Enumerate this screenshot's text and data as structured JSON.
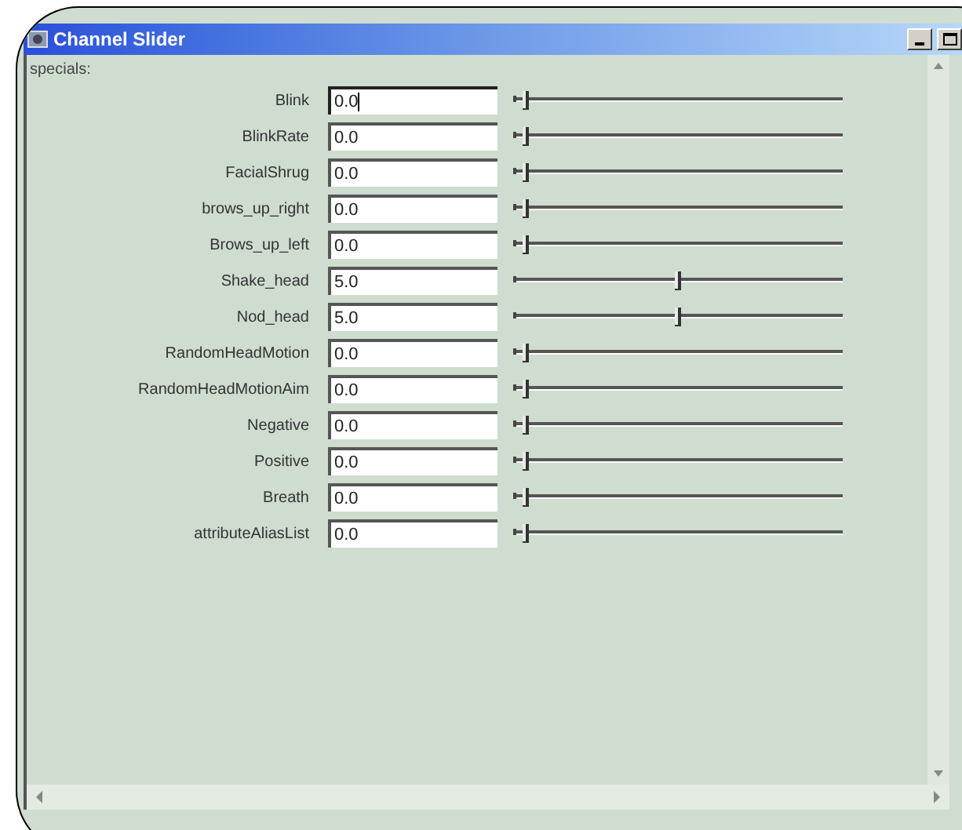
{
  "window": {
    "title": "Channel Slider"
  },
  "section": {
    "label": "specials:"
  },
  "channels": [
    {
      "name": "Blink",
      "value": "0.0",
      "level": 0,
      "focused": true
    },
    {
      "name": "BlinkRate",
      "value": "0.0",
      "level": 0,
      "focused": false
    },
    {
      "name": "FacialShrug",
      "value": "0.0",
      "level": 0,
      "focused": false
    },
    {
      "name": "brows_up_right",
      "value": "0.0",
      "level": 0,
      "focused": false
    },
    {
      "name": "Brows_up_left",
      "value": "0.0",
      "level": 0,
      "focused": false
    },
    {
      "name": "Shake_head",
      "value": "5.0",
      "level": 0.5,
      "focused": false
    },
    {
      "name": "Nod_head",
      "value": "5.0",
      "level": 0.5,
      "focused": false
    },
    {
      "name": "RandomHeadMotion",
      "value": "0.0",
      "level": 0,
      "focused": false
    },
    {
      "name": "RandomHeadMotionAim",
      "value": "0.0",
      "level": 0,
      "focused": false
    },
    {
      "name": "Negative",
      "value": "0.0",
      "level": 0,
      "focused": false
    },
    {
      "name": "Positive",
      "value": "0.0",
      "level": 0,
      "focused": false
    },
    {
      "name": "Breath",
      "value": "0.0",
      "level": 0,
      "focused": false
    },
    {
      "name": "attributeAliasList",
      "value": "0.0",
      "level": 0,
      "focused": false
    }
  ]
}
